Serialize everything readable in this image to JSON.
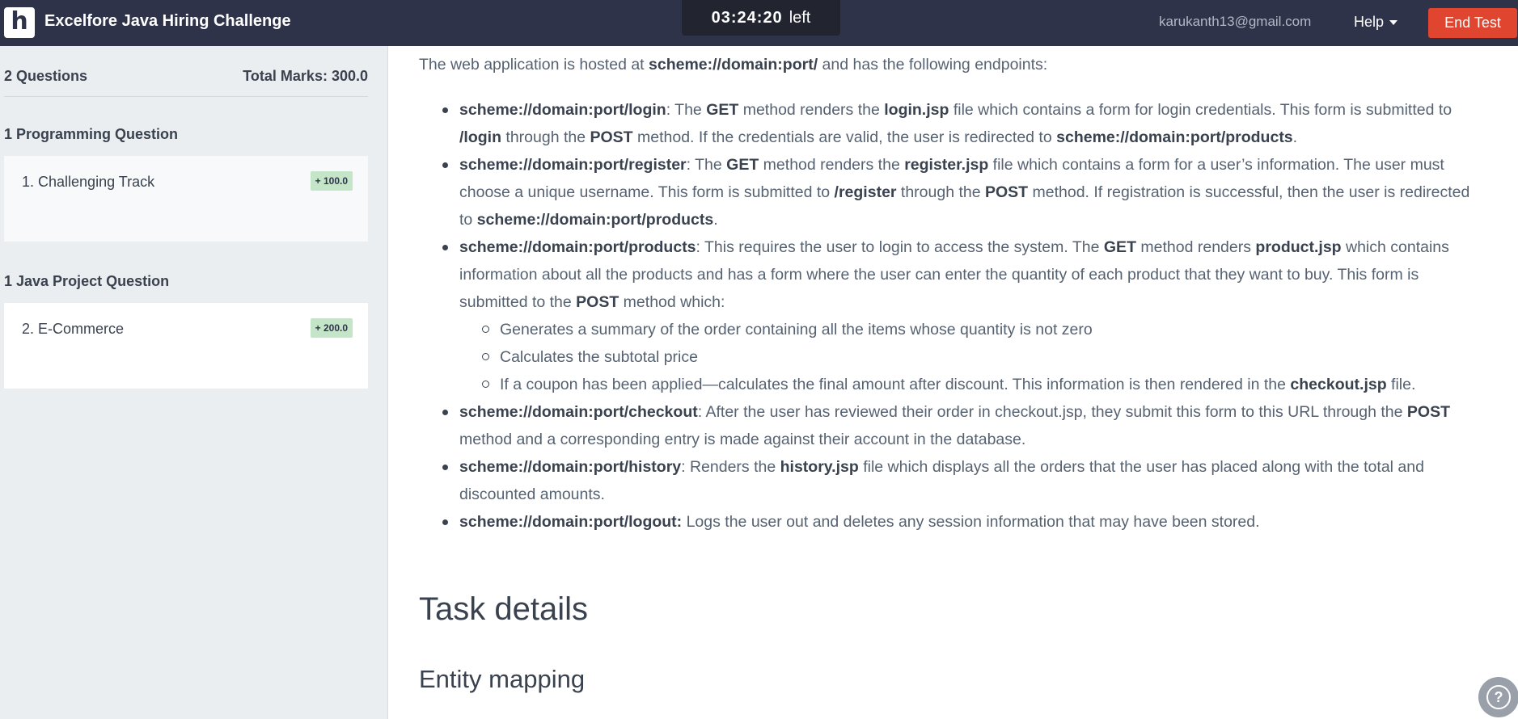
{
  "header": {
    "logo_letter": "h",
    "title": "Excelfore Java Hiring Challenge",
    "timer_value": "03:24:20",
    "timer_suffix": "left",
    "email": "karukanth13@gmail.com",
    "help_label": "Help",
    "end_test_label": "End Test"
  },
  "sidebar": {
    "question_count": "2 Questions",
    "total_marks": "Total Marks: 300.0",
    "groups": [
      {
        "title": "1 Programming Question",
        "question": "1. Challenging Track",
        "badge": "+ 100.0"
      },
      {
        "title": "1 Java Project Question",
        "question": "2. E-Commerce",
        "badge": "+ 200.0"
      }
    ]
  },
  "content": {
    "intro": [
      "The web application is hosted at ",
      "scheme://domain:port/",
      " and has the following endpoints:"
    ],
    "endpoints": [
      [
        "scheme://domain:port/login",
        ": The ",
        "GET",
        " method renders the ",
        "login.jsp",
        " file which contains a form for login credentials. This form is submitted to ",
        "/login",
        " through the ",
        "POST",
        " method. If the credentials are valid, the user is redirected to ",
        "scheme://domain:port/products",
        "."
      ],
      [
        "scheme://domain:port/register",
        ": The ",
        "GET",
        " method renders the ",
        "register.jsp",
        " file which contains a form for a user’s information. The user must choose a unique username. This form is submitted to ",
        "/register",
        " through the ",
        "POST",
        " method. If registration is successful, then the user is redirected to ",
        "scheme://domain:port/products",
        "."
      ],
      [
        "scheme://domain:port/products",
        ": This requires the user to login to access the system. The ",
        "GET",
        " method renders ",
        "product.jsp",
        " which contains information about all the products and has a form where the user can enter the quantity of each product that they want to buy. This form is submitted to the ",
        "POST",
        " method which:"
      ],
      [
        "scheme://domain:port/checkout",
        ": After the user has reviewed their order in checkout.jsp, they submit this form to this URL through the ",
        "POST",
        " method and a corresponding entry is made against their account in the database."
      ],
      [
        "scheme://domain:port/history",
        ": Renders the ",
        "history.jsp",
        " file which displays all the orders that the user has placed along with the total and discounted amounts."
      ],
      [
        "scheme://domain:port/logout:",
        " Logs the user out and deletes any session information that may have been stored."
      ]
    ],
    "products_sub": [
      [
        "Generates a summary of the order containing all the items whose quantity is not zero"
      ],
      [
        "Calculates the subtotal price"
      ],
      [
        "If a coupon has been applied—calculates the final amount after discount. This information is then rendered in the ",
        "checkout.jsp",
        " file."
      ]
    ],
    "heading_task": "Task details",
    "heading_entity": "Entity mapping",
    "help_fab_glyph": "?"
  }
}
